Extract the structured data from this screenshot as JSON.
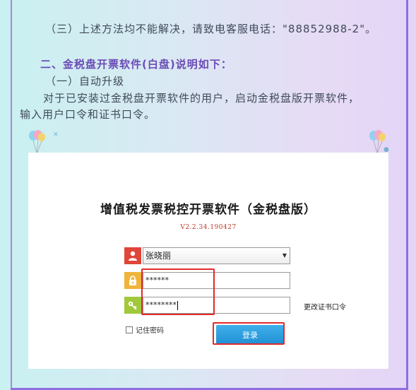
{
  "article": {
    "para1": "（三）上述方法均不能解决，请致电客服电话：\"88852988-2\"。",
    "heading": "二、金税盘开票软件(白盘)说明如下：",
    "sub1": "（一）自动升级",
    "para2_line1": "对于已安装过金税盘开票软件的用户，启动金税盘版开票软件，",
    "para2_line2": "输入用户口令和证书口令。"
  },
  "login": {
    "title": "增值税发票税控开票软件（金税盘版）",
    "version": "V2.2.34.190427",
    "user_selected": "张晓丽",
    "password_value": "******",
    "cert_password_value": "********",
    "change_cert_link": "更改证书口令",
    "remember_label": "记住密码",
    "login_button": "登录"
  },
  "colors": {
    "accent": "#6c4bb6",
    "highlight": "#e12a2a",
    "button": "#1f8fd4"
  },
  "icons": [
    "user-icon",
    "lock-icon",
    "key-icon",
    "balloon-icon"
  ]
}
